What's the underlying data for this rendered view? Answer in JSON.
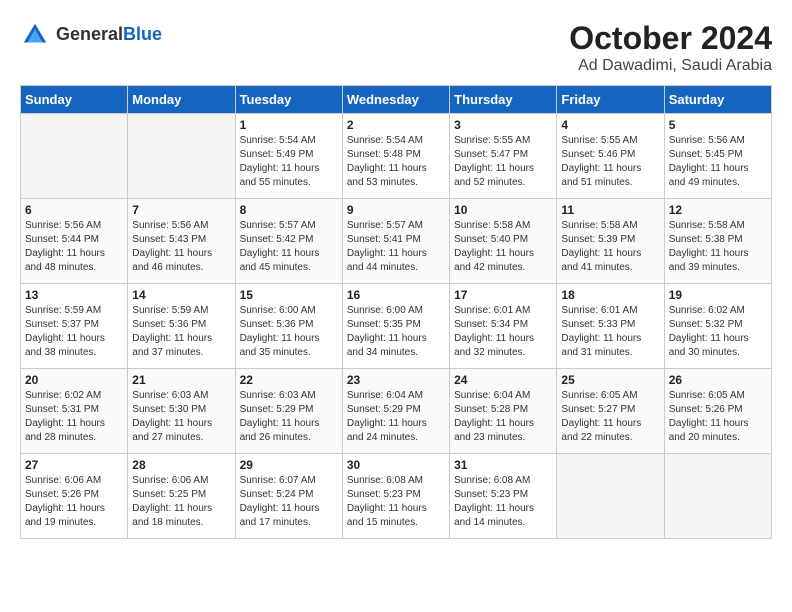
{
  "header": {
    "logo_general": "General",
    "logo_blue": "Blue",
    "month": "October 2024",
    "location": "Ad Dawadimi, Saudi Arabia"
  },
  "weekdays": [
    "Sunday",
    "Monday",
    "Tuesday",
    "Wednesday",
    "Thursday",
    "Friday",
    "Saturday"
  ],
  "weeks": [
    [
      {
        "day": "",
        "empty": true
      },
      {
        "day": "",
        "empty": true
      },
      {
        "day": "1",
        "sunrise": "Sunrise: 5:54 AM",
        "sunset": "Sunset: 5:49 PM",
        "daylight": "Daylight: 11 hours and 55 minutes."
      },
      {
        "day": "2",
        "sunrise": "Sunrise: 5:54 AM",
        "sunset": "Sunset: 5:48 PM",
        "daylight": "Daylight: 11 hours and 53 minutes."
      },
      {
        "day": "3",
        "sunrise": "Sunrise: 5:55 AM",
        "sunset": "Sunset: 5:47 PM",
        "daylight": "Daylight: 11 hours and 52 minutes."
      },
      {
        "day": "4",
        "sunrise": "Sunrise: 5:55 AM",
        "sunset": "Sunset: 5:46 PM",
        "daylight": "Daylight: 11 hours and 51 minutes."
      },
      {
        "day": "5",
        "sunrise": "Sunrise: 5:56 AM",
        "sunset": "Sunset: 5:45 PM",
        "daylight": "Daylight: 11 hours and 49 minutes."
      }
    ],
    [
      {
        "day": "6",
        "sunrise": "Sunrise: 5:56 AM",
        "sunset": "Sunset: 5:44 PM",
        "daylight": "Daylight: 11 hours and 48 minutes."
      },
      {
        "day": "7",
        "sunrise": "Sunrise: 5:56 AM",
        "sunset": "Sunset: 5:43 PM",
        "daylight": "Daylight: 11 hours and 46 minutes."
      },
      {
        "day": "8",
        "sunrise": "Sunrise: 5:57 AM",
        "sunset": "Sunset: 5:42 PM",
        "daylight": "Daylight: 11 hours and 45 minutes."
      },
      {
        "day": "9",
        "sunrise": "Sunrise: 5:57 AM",
        "sunset": "Sunset: 5:41 PM",
        "daylight": "Daylight: 11 hours and 44 minutes."
      },
      {
        "day": "10",
        "sunrise": "Sunrise: 5:58 AM",
        "sunset": "Sunset: 5:40 PM",
        "daylight": "Daylight: 11 hours and 42 minutes."
      },
      {
        "day": "11",
        "sunrise": "Sunrise: 5:58 AM",
        "sunset": "Sunset: 5:39 PM",
        "daylight": "Daylight: 11 hours and 41 minutes."
      },
      {
        "day": "12",
        "sunrise": "Sunrise: 5:58 AM",
        "sunset": "Sunset: 5:38 PM",
        "daylight": "Daylight: 11 hours and 39 minutes."
      }
    ],
    [
      {
        "day": "13",
        "sunrise": "Sunrise: 5:59 AM",
        "sunset": "Sunset: 5:37 PM",
        "daylight": "Daylight: 11 hours and 38 minutes."
      },
      {
        "day": "14",
        "sunrise": "Sunrise: 5:59 AM",
        "sunset": "Sunset: 5:36 PM",
        "daylight": "Daylight: 11 hours and 37 minutes."
      },
      {
        "day": "15",
        "sunrise": "Sunrise: 6:00 AM",
        "sunset": "Sunset: 5:36 PM",
        "daylight": "Daylight: 11 hours and 35 minutes."
      },
      {
        "day": "16",
        "sunrise": "Sunrise: 6:00 AM",
        "sunset": "Sunset: 5:35 PM",
        "daylight": "Daylight: 11 hours and 34 minutes."
      },
      {
        "day": "17",
        "sunrise": "Sunrise: 6:01 AM",
        "sunset": "Sunset: 5:34 PM",
        "daylight": "Daylight: 11 hours and 32 minutes."
      },
      {
        "day": "18",
        "sunrise": "Sunrise: 6:01 AM",
        "sunset": "Sunset: 5:33 PM",
        "daylight": "Daylight: 11 hours and 31 minutes."
      },
      {
        "day": "19",
        "sunrise": "Sunrise: 6:02 AM",
        "sunset": "Sunset: 5:32 PM",
        "daylight": "Daylight: 11 hours and 30 minutes."
      }
    ],
    [
      {
        "day": "20",
        "sunrise": "Sunrise: 6:02 AM",
        "sunset": "Sunset: 5:31 PM",
        "daylight": "Daylight: 11 hours and 28 minutes."
      },
      {
        "day": "21",
        "sunrise": "Sunrise: 6:03 AM",
        "sunset": "Sunset: 5:30 PM",
        "daylight": "Daylight: 11 hours and 27 minutes."
      },
      {
        "day": "22",
        "sunrise": "Sunrise: 6:03 AM",
        "sunset": "Sunset: 5:29 PM",
        "daylight": "Daylight: 11 hours and 26 minutes."
      },
      {
        "day": "23",
        "sunrise": "Sunrise: 6:04 AM",
        "sunset": "Sunset: 5:29 PM",
        "daylight": "Daylight: 11 hours and 24 minutes."
      },
      {
        "day": "24",
        "sunrise": "Sunrise: 6:04 AM",
        "sunset": "Sunset: 5:28 PM",
        "daylight": "Daylight: 11 hours and 23 minutes."
      },
      {
        "day": "25",
        "sunrise": "Sunrise: 6:05 AM",
        "sunset": "Sunset: 5:27 PM",
        "daylight": "Daylight: 11 hours and 22 minutes."
      },
      {
        "day": "26",
        "sunrise": "Sunrise: 6:05 AM",
        "sunset": "Sunset: 5:26 PM",
        "daylight": "Daylight: 11 hours and 20 minutes."
      }
    ],
    [
      {
        "day": "27",
        "sunrise": "Sunrise: 6:06 AM",
        "sunset": "Sunset: 5:26 PM",
        "daylight": "Daylight: 11 hours and 19 minutes."
      },
      {
        "day": "28",
        "sunrise": "Sunrise: 6:06 AM",
        "sunset": "Sunset: 5:25 PM",
        "daylight": "Daylight: 11 hours and 18 minutes."
      },
      {
        "day": "29",
        "sunrise": "Sunrise: 6:07 AM",
        "sunset": "Sunset: 5:24 PM",
        "daylight": "Daylight: 11 hours and 17 minutes."
      },
      {
        "day": "30",
        "sunrise": "Sunrise: 6:08 AM",
        "sunset": "Sunset: 5:23 PM",
        "daylight": "Daylight: 11 hours and 15 minutes."
      },
      {
        "day": "31",
        "sunrise": "Sunrise: 6:08 AM",
        "sunset": "Sunset: 5:23 PM",
        "daylight": "Daylight: 11 hours and 14 minutes."
      },
      {
        "day": "",
        "empty": true
      },
      {
        "day": "",
        "empty": true
      }
    ]
  ]
}
